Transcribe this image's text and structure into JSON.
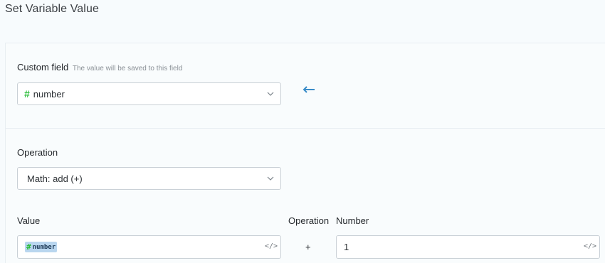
{
  "header": {
    "title": "Set Variable Value"
  },
  "custom_field": {
    "label": "Custom field",
    "hint": "The value will be saved to this field",
    "selected_value": "number",
    "selected_icon": "hash-icon",
    "arrow_icon": "arrow-left-icon"
  },
  "operation": {
    "label": "Operation",
    "selected_value": "Math: add (+)"
  },
  "expression": {
    "value_label": "Value",
    "operation_label": "Operation",
    "number_label": "Number",
    "value_token": "number",
    "operator": "+",
    "number_value": "1",
    "code_icon": "</>"
  },
  "colors": {
    "accent_blue": "#3a8cc8",
    "hash_green": "#2bbd3a",
    "token_bg": "#b9d6ef"
  }
}
